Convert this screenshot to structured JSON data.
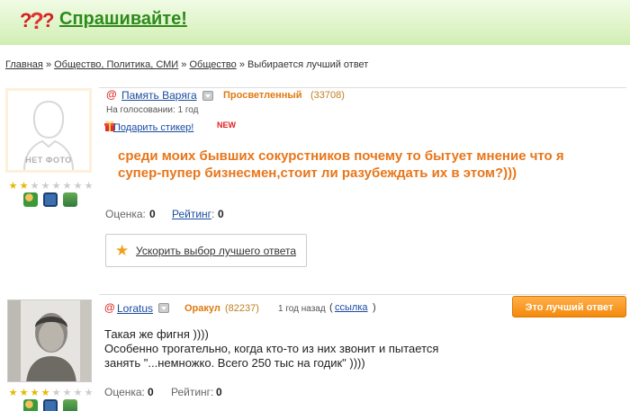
{
  "header": {
    "title": "Спрашивайте!"
  },
  "breadcrumb": {
    "items": [
      "Главная",
      "Общество, Политика, СМИ",
      "Общество"
    ],
    "current": "Выбирается лучший ответ",
    "separator": "»"
  },
  "question": {
    "avatar_text": "НЕТ ФОТО",
    "stars": 2,
    "stars_total": 8,
    "user": {
      "name": "Память Варяга",
      "rank": "Просветленный",
      "points": "(33708)"
    },
    "vote_time": "На голосовании: 1 год",
    "gift_label": "Подарить стикер!",
    "gift_new": "NEW",
    "text": "среди моих бывших сокурстников почему то бытует мнение что я супер-пупер бизнесмен,стоит ли разубеждать их в этом?)))",
    "score_label": "Оценка:",
    "score_value": "0",
    "rating_label": "Рейтинг",
    "rating_value": "0",
    "speed_label": "Ускорить выбор лучшего ответа"
  },
  "answer": {
    "stars": 4,
    "stars_total": 8,
    "user": {
      "name": "Loratus",
      "rank": "Оракул",
      "points": "(82237)"
    },
    "time": "1 год назад",
    "link_label": "ссылка",
    "best_button": "Это лучший ответ",
    "text_lines": [
      "Такая же фигня ))))",
      "Особенно трогательно, когда кто-то из них звонит и пытается",
      "занять \"...немножко. Всего 250 тыс на годик\" ))))"
    ],
    "score_label": "Оценка:",
    "score_value": "0",
    "rating_label": "Рейтинг:",
    "rating_value": "0"
  },
  "colors": {
    "brand_green": "#2d8a1d",
    "rank_orange": "#e07a10",
    "question_orange": "#e8761a",
    "link_blue": "#1a4ca0",
    "best_button": "#f48a0c"
  }
}
